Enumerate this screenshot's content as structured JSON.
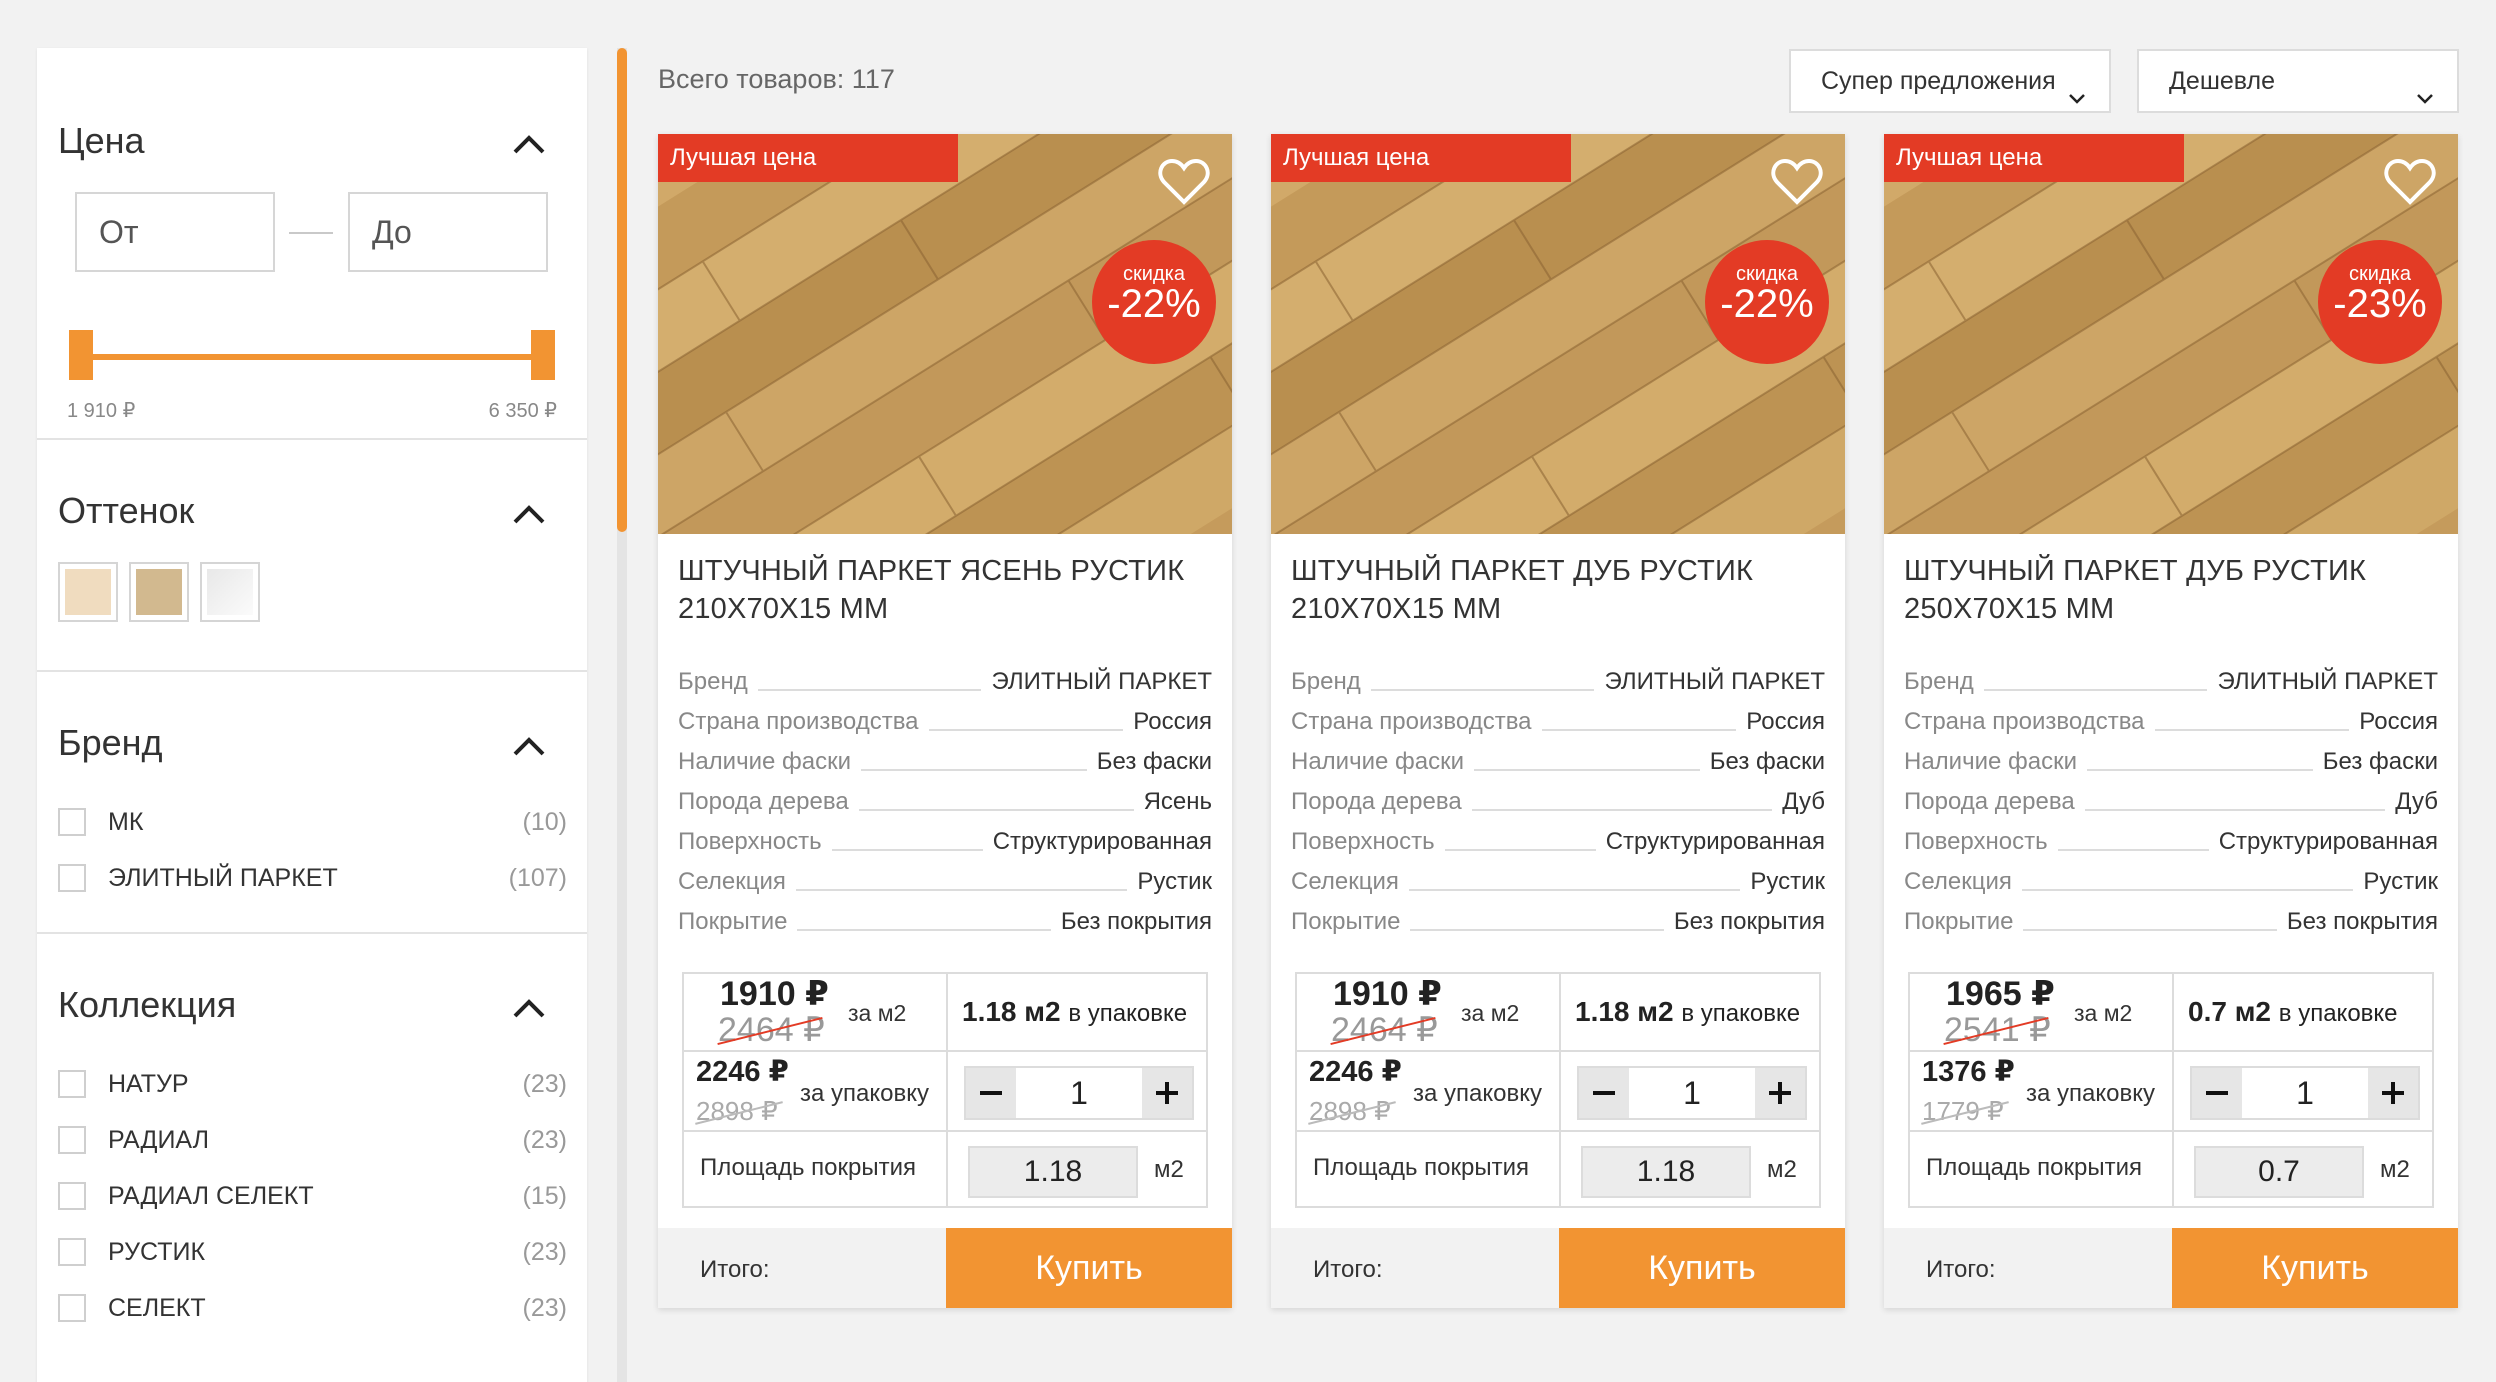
{
  "filters": {
    "price": {
      "title": "Цена",
      "from_placeholder": "От",
      "to_placeholder": "До",
      "min_label": "1 910 ₽",
      "max_label": "6 350 ₽"
    },
    "shade": {
      "title": "Оттенок",
      "swatches": [
        "#f0dcbf",
        "#d2b98f",
        "#f3f3f3"
      ]
    },
    "brand": {
      "title": "Бренд",
      "items": [
        {
          "label": "МК",
          "count": "(10)"
        },
        {
          "label": "ЭЛИТНЫЙ ПАРКЕТ",
          "count": "(107)"
        }
      ]
    },
    "collection": {
      "title": "Коллекция",
      "items": [
        {
          "label": "НАТУР",
          "count": "(23)"
        },
        {
          "label": "РАДИАЛ",
          "count": "(23)"
        },
        {
          "label": "РАДИАЛ СЕЛЕКТ",
          "count": "(15)"
        },
        {
          "label": "РУСТИК",
          "count": "(23)"
        },
        {
          "label": "СЕЛЕКТ",
          "count": "(23)"
        }
      ]
    }
  },
  "toolbar": {
    "total": "Всего товаров: 117",
    "filter_select": "Супер предложения",
    "sort_select": "Дешевле"
  },
  "colors": {
    "accent": "#f29432",
    "badge_red": "#e33b25"
  },
  "products": [
    {
      "badge": "Лучшая цена",
      "discount_label": "скидка",
      "discount": "-22%",
      "title_line1": "ШТУЧНЫЙ ПАРКЕТ ЯСЕНЬ РУСТИК",
      "title_line2": "210Х70Х15 ММ",
      "specs": [
        {
          "k": "Бренд",
          "v": "ЭЛИТНЫЙ ПАРКЕТ"
        },
        {
          "k": "Страна производства",
          "v": "Россия"
        },
        {
          "k": "Наличие фаски",
          "v": "Без фаски"
        },
        {
          "k": "Порода дерева",
          "v": "Ясень"
        },
        {
          "k": "Поверхность",
          "v": "Структурированная"
        },
        {
          "k": "Селекция",
          "v": "Рустик"
        },
        {
          "k": "Покрытие",
          "v": "Без покрытия"
        }
      ],
      "price": "1910 ₽",
      "old_price": "2464 ₽",
      "per_unit": "за м2",
      "pack_price": "2246 ₽",
      "pack_old_price": "2898 ₽",
      "per_pack": "за упаковку",
      "pack_size": "1.18 м2",
      "pack_size_label": "в упаковке",
      "qty": "1",
      "area_label": "Площадь покрытия",
      "area": "1.18",
      "area_unit": "м2",
      "total_label": "Итого:",
      "buy": "Купить"
    },
    {
      "badge": "Лучшая цена",
      "discount_label": "скидка",
      "discount": "-22%",
      "title_line1": "ШТУЧНЫЙ ПАРКЕТ ДУБ РУСТИК",
      "title_line2": "210Х70Х15 ММ",
      "specs": [
        {
          "k": "Бренд",
          "v": "ЭЛИТНЫЙ ПАРКЕТ"
        },
        {
          "k": "Страна производства",
          "v": "Россия"
        },
        {
          "k": "Наличие фаски",
          "v": "Без фаски"
        },
        {
          "k": "Порода дерева",
          "v": "Дуб"
        },
        {
          "k": "Поверхность",
          "v": "Структурированная"
        },
        {
          "k": "Селекция",
          "v": "Рустик"
        },
        {
          "k": "Покрытие",
          "v": "Без покрытия"
        }
      ],
      "price": "1910 ₽",
      "old_price": "2464 ₽",
      "per_unit": "за м2",
      "pack_price": "2246 ₽",
      "pack_old_price": "2898 ₽",
      "per_pack": "за упаковку",
      "pack_size": "1.18 м2",
      "pack_size_label": "в упаковке",
      "qty": "1",
      "area_label": "Площадь покрытия",
      "area": "1.18",
      "area_unit": "м2",
      "total_label": "Итого:",
      "buy": "Купить"
    },
    {
      "badge": "Лучшая цена",
      "discount_label": "скидка",
      "discount": "-23%",
      "title_line1": "ШТУЧНЫЙ ПАРКЕТ ДУБ РУСТИК",
      "title_line2": "250Х70Х15 ММ",
      "specs": [
        {
          "k": "Бренд",
          "v": "ЭЛИТНЫЙ ПАРКЕТ"
        },
        {
          "k": "Страна производства",
          "v": "Россия"
        },
        {
          "k": "Наличие фаски",
          "v": "Без фаски"
        },
        {
          "k": "Порода дерева",
          "v": "Дуб"
        },
        {
          "k": "Поверхность",
          "v": "Структурированная"
        },
        {
          "k": "Селекция",
          "v": "Рустик"
        },
        {
          "k": "Покрытие",
          "v": "Без покрытия"
        }
      ],
      "price": "1965 ₽",
      "old_price": "2541 ₽",
      "per_unit": "за м2",
      "pack_price": "1376 ₽",
      "pack_old_price": "1779 ₽",
      "per_pack": "за упаковку",
      "pack_size": "0.7 м2",
      "pack_size_label": "в упаковке",
      "qty": "1",
      "area_label": "Площадь покрытия",
      "area": "0.7",
      "area_unit": "м2",
      "total_label": "Итого:",
      "buy": "Купить"
    }
  ]
}
